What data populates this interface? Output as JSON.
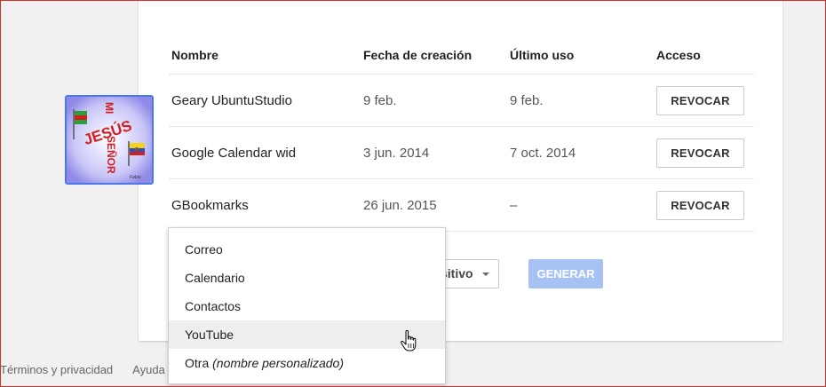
{
  "avatar": {
    "lines": [
      "JESÚS",
      "MI",
      "SEÑOR"
    ],
    "signature": "Fabio"
  },
  "table": {
    "headers": [
      "Nombre",
      "Fecha de creación",
      "Último uso",
      "Acceso"
    ],
    "rows": [
      {
        "name": "Geary UbuntuStudio",
        "created": "9 feb.",
        "last_used": "9 feb.",
        "action": "REVOCAR"
      },
      {
        "name": "Google Calendar wid",
        "created": "3 jun. 2014",
        "last_used": "7 oct. 2014",
        "action": "REVOCAR"
      },
      {
        "name": "GBookmarks",
        "created": "26 jun. 2015",
        "last_used": "–",
        "action": "REVOCAR"
      }
    ]
  },
  "generator": {
    "device_select_visible": "sitivo",
    "generate_label": "GENERAR",
    "generate_color": "#a6c2f5"
  },
  "app_menu": {
    "items": [
      "Correo",
      "Calendario",
      "Contactos",
      "YouTube"
    ],
    "other_prefix": "Otra ",
    "other_italic": "(nombre personalizado)",
    "hovered": "YouTube"
  },
  "footer": {
    "terms": "Términos y privacidad",
    "help": "Ayuda"
  }
}
